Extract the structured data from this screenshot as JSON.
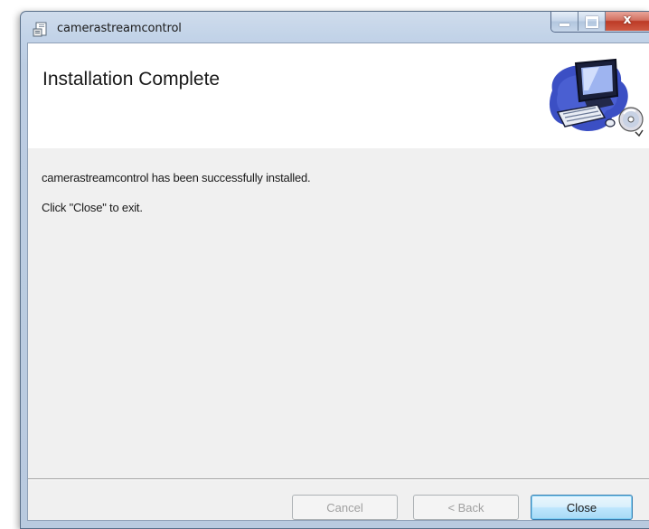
{
  "window": {
    "title": "camerastreamcontrol",
    "icon": "installer-package-icon",
    "controls": {
      "minimize_icon": "minimize-icon",
      "maximize_icon": "maximize-icon",
      "close_glyph": "x"
    }
  },
  "banner": {
    "title": "Installation Complete",
    "graphic": "computer-cd-icon"
  },
  "body": {
    "message": "camerastreamcontrol has been successfully installed.",
    "instruction": "Click \"Close\" to exit."
  },
  "buttons": {
    "cancel_label": "Cancel",
    "back_label": "< Back",
    "close_label": "Close"
  },
  "colors": {
    "frame": "#c2d3e8",
    "close_button": "#c9463a",
    "client_bg": "#f0f0f0",
    "default_button_border": "#3c7fb1"
  }
}
